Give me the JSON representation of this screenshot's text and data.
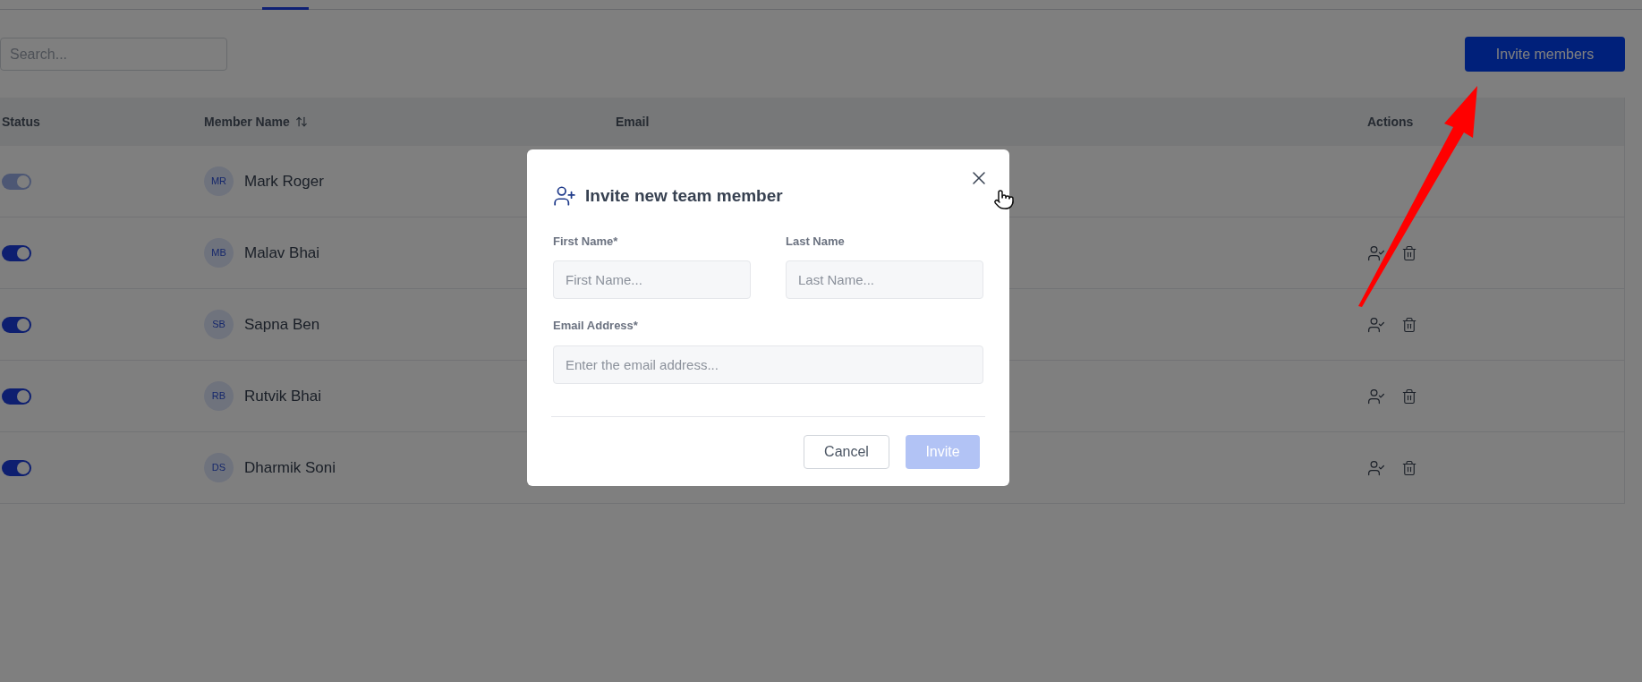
{
  "search": {
    "placeholder": "Search..."
  },
  "invite_button": "Invite members",
  "table": {
    "columns": [
      {
        "label": "Status",
        "sortable": false
      },
      {
        "label": "Member Name",
        "sortable": true
      },
      {
        "label": "Email",
        "sortable": false
      },
      {
        "label": "Actions",
        "sortable": false
      }
    ],
    "rows": [
      {
        "initials": "MR",
        "name": "Mark Roger",
        "on": true,
        "disabled": true
      },
      {
        "initials": "MB",
        "name": "Malav Bhai",
        "on": true,
        "disabled": false
      },
      {
        "initials": "SB",
        "name": "Sapna Ben",
        "on": true,
        "disabled": false
      },
      {
        "initials": "RB",
        "name": "Rutvik Bhai",
        "on": true,
        "disabled": false
      },
      {
        "initials": "DS",
        "name": "Dharmik Soni",
        "on": true,
        "disabled": false
      }
    ]
  },
  "dialog": {
    "title": "Invite new team member",
    "fields": [
      {
        "label": "First Name*",
        "placeholder": "First Name..."
      },
      {
        "label": "Last Name",
        "placeholder": "Last Name..."
      },
      {
        "label": "Email Address*",
        "placeholder": "Enter the email address..."
      }
    ],
    "cancel": "Cancel",
    "submit": {
      "label": "Invite",
      "disabled": true
    }
  }
}
